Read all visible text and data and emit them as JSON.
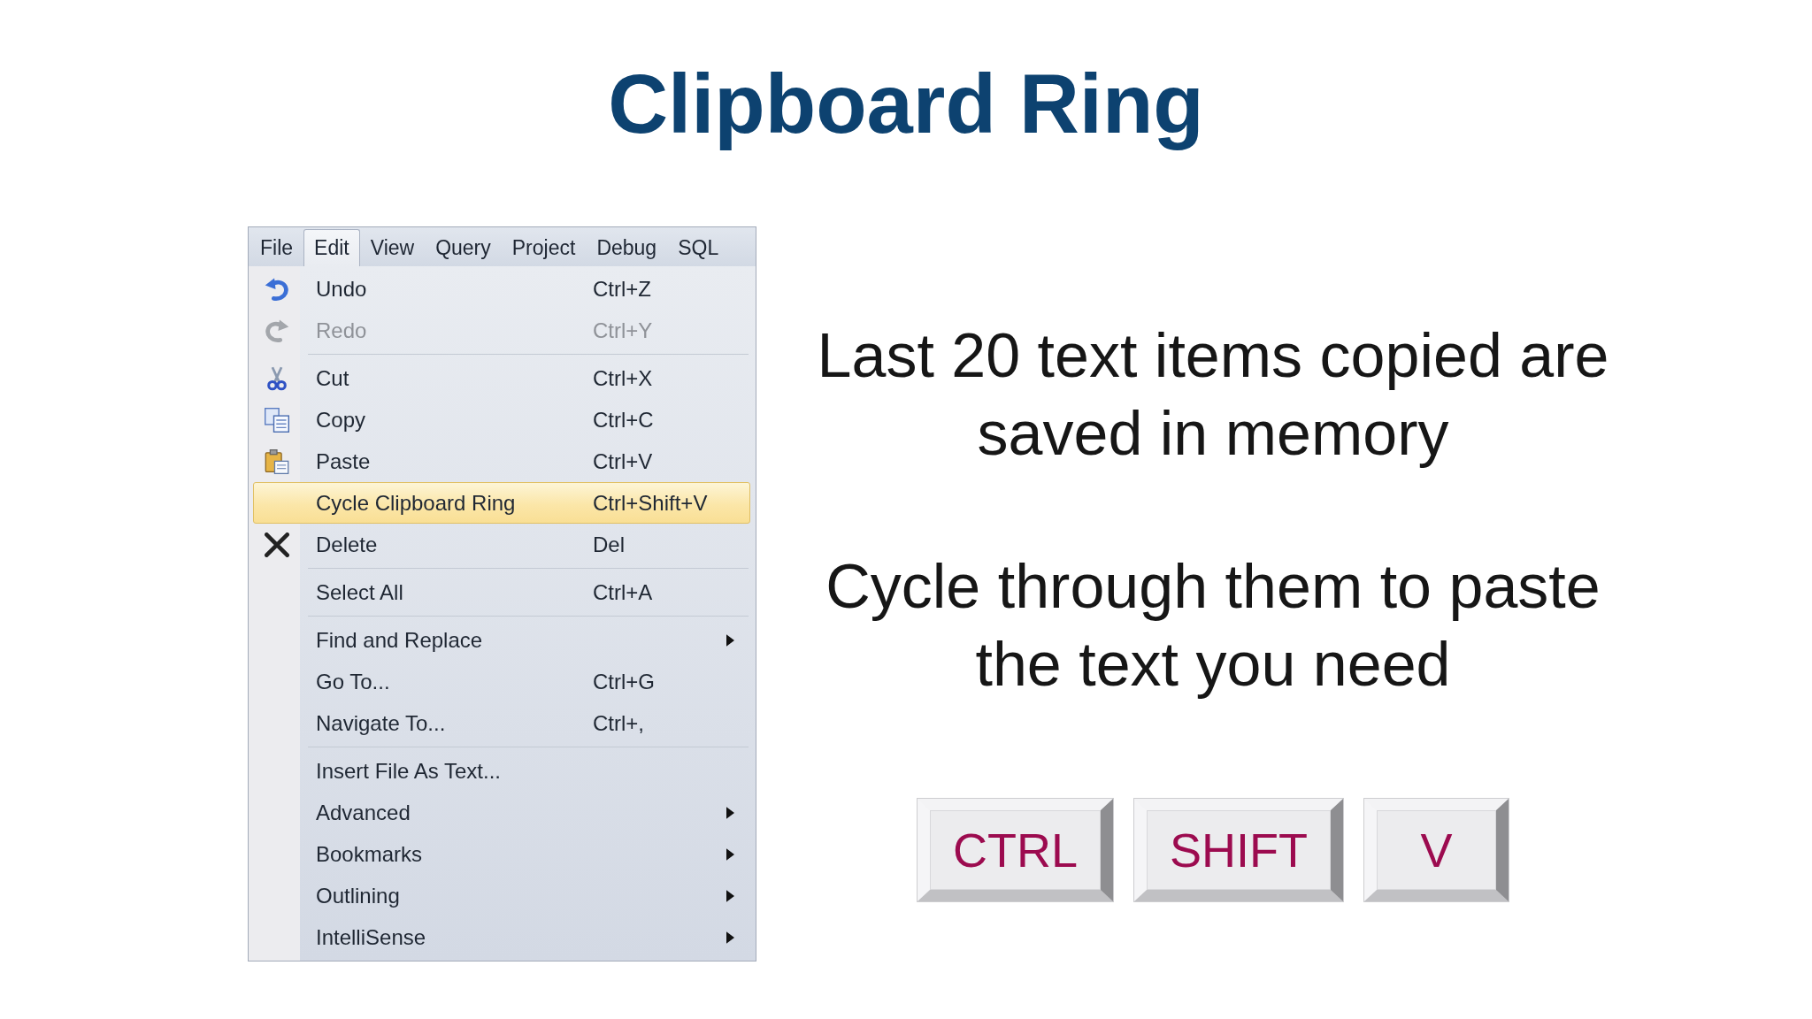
{
  "title": "Clipboard Ring",
  "menu": {
    "menubar": [
      {
        "label": "File",
        "selected": false
      },
      {
        "label": "Edit",
        "selected": true
      },
      {
        "label": "View",
        "selected": false
      },
      {
        "label": "Query",
        "selected": false
      },
      {
        "label": "Project",
        "selected": false
      },
      {
        "label": "Debug",
        "selected": false
      },
      {
        "label": "SQL",
        "selected": false
      }
    ],
    "groups": [
      {
        "items": [
          {
            "label": "Undo",
            "shortcut": "Ctrl+Z",
            "disabled": false,
            "selected": false,
            "submenu": false
          },
          {
            "label": "Redo",
            "shortcut": "Ctrl+Y",
            "disabled": true,
            "selected": false,
            "submenu": false
          }
        ]
      },
      {
        "items": [
          {
            "label": "Cut",
            "shortcut": "Ctrl+X",
            "disabled": false,
            "selected": false,
            "submenu": false
          },
          {
            "label": "Copy",
            "shortcut": "Ctrl+C",
            "disabled": false,
            "selected": false,
            "submenu": false
          },
          {
            "label": "Paste",
            "shortcut": "Ctrl+V",
            "disabled": false,
            "selected": false,
            "submenu": false
          },
          {
            "label": "Cycle Clipboard Ring",
            "shortcut": "Ctrl+Shift+V",
            "disabled": false,
            "selected": true,
            "submenu": false
          },
          {
            "label": "Delete",
            "shortcut": "Del",
            "disabled": false,
            "selected": false,
            "submenu": false
          }
        ]
      },
      {
        "items": [
          {
            "label": "Select All",
            "shortcut": "Ctrl+A",
            "disabled": false,
            "selected": false,
            "submenu": false
          }
        ]
      },
      {
        "items": [
          {
            "label": "Find and Replace",
            "disabled": false,
            "selected": false,
            "submenu": true
          },
          {
            "label": "Go To...",
            "shortcut": "Ctrl+G",
            "disabled": false,
            "selected": false,
            "submenu": false
          },
          {
            "label": "Navigate To...",
            "shortcut": "Ctrl+,",
            "disabled": false,
            "selected": false,
            "submenu": false
          }
        ]
      },
      {
        "items": [
          {
            "label": "Insert File As Text...",
            "disabled": false,
            "selected": false,
            "submenu": false
          },
          {
            "label": "Advanced",
            "disabled": false,
            "selected": false,
            "submenu": true
          },
          {
            "label": "Bookmarks",
            "disabled": false,
            "selected": false,
            "submenu": true
          },
          {
            "label": "Outlining",
            "disabled": false,
            "selected": false,
            "submenu": true
          },
          {
            "label": "IntelliSense",
            "disabled": false,
            "selected": false,
            "submenu": true
          }
        ]
      }
    ]
  },
  "notes": [
    "Last 20 text items copied are saved in memory",
    "Cycle through them to paste the text you need"
  ],
  "keys": [
    "CTRL",
    "SHIFT",
    "V"
  ]
}
